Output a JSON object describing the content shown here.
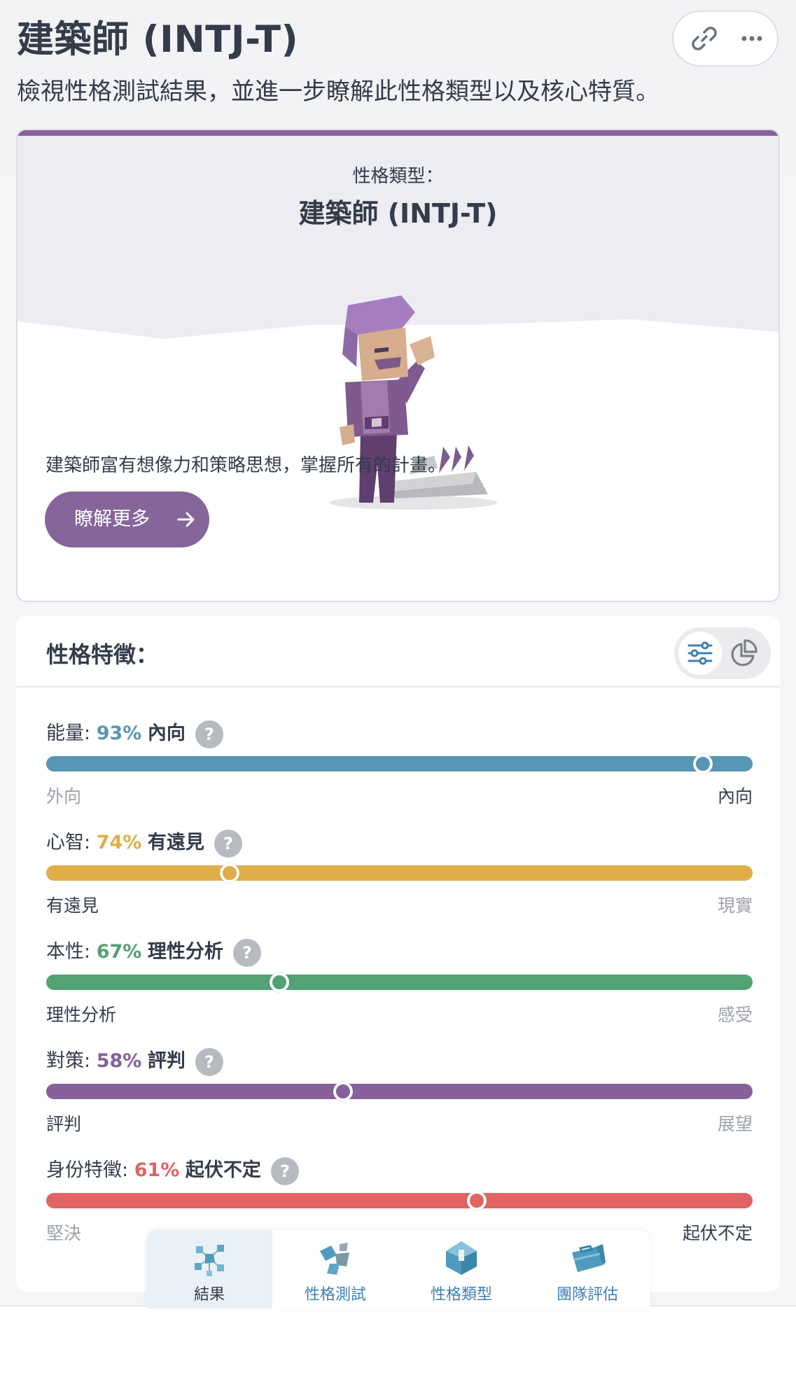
{
  "header": {
    "title": "建築師 (INTJ-T)",
    "subtitle": "檢視性格測試結果，並進一步瞭解此性格類型以及核心特質。",
    "icons": [
      "link-icon",
      "more-icon"
    ]
  },
  "type_card": {
    "label": "性格類型：",
    "name": "建築師 (INTJ-T)",
    "description": "建築師富有想像力和策略思想，掌握所有的計畫。",
    "button_label": "瞭解更多",
    "accent_color": "#88619a"
  },
  "traits": {
    "title": "性格特徵：",
    "view_icons": [
      "sliders-icon",
      "pie-chart-icon"
    ],
    "items": [
      {
        "name": "能量",
        "percent": "93%",
        "dominant": "內向",
        "left": "外向",
        "right": "內向",
        "position": 0.93,
        "active_side": "right",
        "color": "#5797b4"
      },
      {
        "name": "心智",
        "percent": "74%",
        "dominant": "有遠見",
        "left": "有遠見",
        "right": "現實",
        "position": 0.26,
        "active_side": "left",
        "color": "#e0ad49"
      },
      {
        "name": "本性",
        "percent": "67%",
        "dominant": "理性分析",
        "left": "理性分析",
        "right": "感受",
        "position": 0.33,
        "active_side": "left",
        "color": "#52a274"
      },
      {
        "name": "對策",
        "percent": "58%",
        "dominant": "評判",
        "left": "評判",
        "right": "展望",
        "position": 0.42,
        "active_side": "left",
        "color": "#86619a"
      },
      {
        "name": "身份特徵",
        "percent": "61%",
        "dominant": "起伏不定",
        "left": "堅決",
        "right": "起伏不定",
        "position": 0.61,
        "active_side": "right",
        "color": "#e16464"
      }
    ]
  },
  "bottom_nav": {
    "items": [
      {
        "label": "結果",
        "icon": "molecule-icon",
        "active": true
      },
      {
        "label": "性格測試",
        "icon": "test-shapes-icon",
        "active": false
      },
      {
        "label": "性格類型",
        "icon": "gem-icon",
        "active": false
      },
      {
        "label": "團隊評估",
        "icon": "briefcase-icon",
        "active": false
      }
    ]
  }
}
